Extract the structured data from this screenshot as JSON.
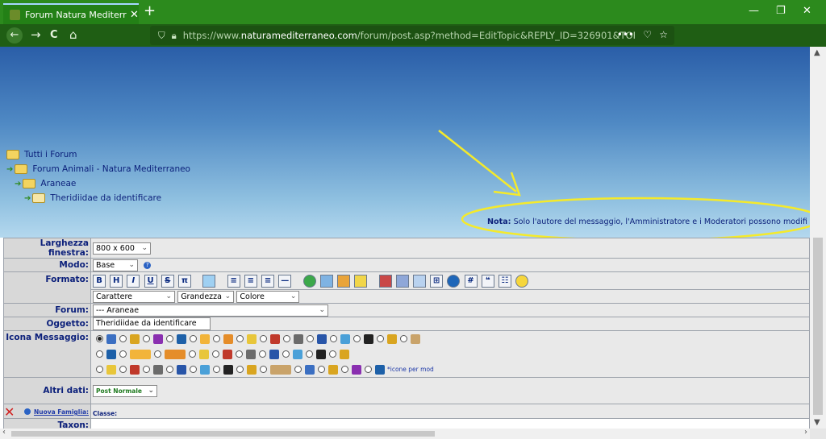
{
  "browser": {
    "tab_title": "Forum Natura Mediterraneo | F",
    "tab_close": "✕",
    "new_tab": "+",
    "minimize": "—",
    "restore": "❐",
    "close": "✕",
    "back": "←",
    "forward": "→",
    "reload": "C",
    "home": "⌂",
    "url_prefix": "https://www.",
    "url_host": "naturamediterraneo.com",
    "url_path": "/forum/post.asp?method=EditTopic&REPLY_ID=326901&TOPIC_ID=326901&F",
    "url_more": "•••",
    "pocket": "♡",
    "bookmark": "☆",
    "library": "⇧",
    "download": "⤓",
    "account": "◉",
    "menu": "≡"
  },
  "breadcrumb": {
    "items": [
      "Tutti i Forum",
      "Forum Animali - Natura Mediterraneo",
      "Araneae",
      "Theridiidae da identificare"
    ]
  },
  "note": {
    "label": "Nota:",
    "text": " Solo l'autore del messaggio, l'Amministratore e i Moderatori possono modifi"
  },
  "form": {
    "larghezza": {
      "label": "Larghezza finestra:",
      "value": "800 x 600"
    },
    "modo": {
      "label": "Modo:",
      "value": "Base",
      "help": "?"
    },
    "formato": {
      "label": "Formato:",
      "buttons": [
        "B",
        "H",
        "I",
        "U",
        "S",
        "π"
      ],
      "selects": [
        "Carattere",
        "Grandezza",
        "Colore"
      ]
    },
    "forum": {
      "label": "Forum:",
      "value": "--- Araneae"
    },
    "oggetto": {
      "label": "Oggetto:",
      "value": "Theridiidae da identificare"
    },
    "icona": {
      "label": "Icona Messaggio:",
      "mod_text": "*icone per mod"
    },
    "altri_dati": {
      "label": "Altri dati:",
      "value": "Post Normale"
    },
    "famiglia": {
      "link": "Nuova Famiglia:",
      "classe": "Classe:"
    },
    "taxon": {
      "label": "Taxon:"
    }
  },
  "icon_colors": [
    "#3b6fc2",
    "#d9a520",
    "#8a2fb0",
    "#1d60a8",
    "#f2b43a",
    "#e58d2a",
    "#e8c63a",
    "#c0392b",
    "#6b6b6b",
    "#2855a8",
    "#4aa0d8",
    "#222222",
    "#d9a520",
    "#c9a36a"
  ]
}
